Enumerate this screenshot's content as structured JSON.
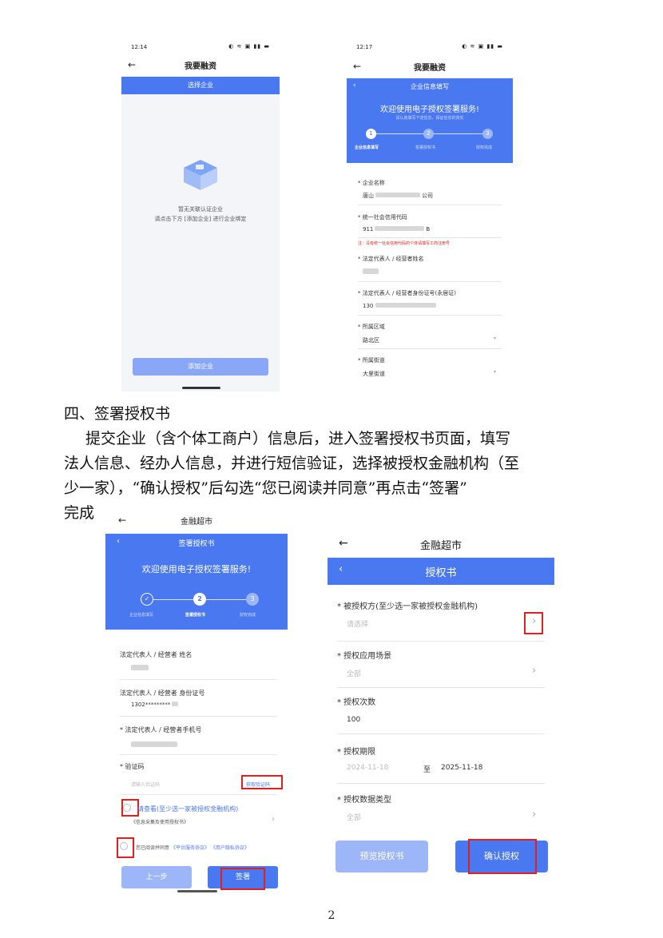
{
  "s1": {
    "time": "12:14",
    "status_icons": "◐ ≋ ▣ ▮▮ ▬",
    "title": "我要融资",
    "tab": "选择企业",
    "empty_line1": "暂无关联认证企业",
    "empty_line2": "请点击下方 [添加企业] 进行企业绑定",
    "add_button": "添加企业"
  },
  "s2": {
    "time": "12:17",
    "status_icons": "◐ ≋ ▣ ▮▮ ▬",
    "title": "我要融资",
    "header": "企业信息填写",
    "welcome": "欢迎使用电子授权签署服务!",
    "sub": "请认真填写下述信息，保证信息的真实",
    "steps": [
      {
        "num": "1",
        "label": "企业信息填写"
      },
      {
        "num": "2",
        "label": "签署授权书"
      },
      {
        "num": "3",
        "label": "授权完成"
      }
    ],
    "fields": [
      {
        "label": "* 企业名称",
        "value": "唐山",
        "suffix": "公司"
      },
      {
        "label": "* 统一社会信用代码",
        "value": "911",
        "suffix": "B"
      },
      {
        "label": "* 法定代表人 / 经营者姓名",
        "value": "",
        "suffix": ""
      },
      {
        "label": "* 法定代表人 / 经营者身份证号(永居证)",
        "value": "130",
        "suffix": ""
      },
      {
        "label": "* 所属区域",
        "value": "路北区",
        "suffix": ""
      },
      {
        "label": "* 所属街道",
        "value": "大里街道",
        "suffix": ""
      }
    ],
    "note": "注：没有统一社会信用代码的个体请填写工商注册号"
  },
  "doc": {
    "heading": "四、签署授权书",
    "para_line1": "提交企业（含个体工商户）信息后，进入签署授权书页面，填写",
    "para_line2": "法人信息、经办人信息，并进行短信验证，选择被授权金融机构（至",
    "para_line3": "少一家），“确认授权”后勾选“您已阅读并同意”再点击“签署”",
    "para_line4": "完成",
    "page_number": "2"
  },
  "s3": {
    "title": "金融超市",
    "header": "签署授权书",
    "welcome": "欢迎使用电子授权签署服务!",
    "steps": [
      {
        "num": "✓",
        "label": "企业信息填写"
      },
      {
        "num": "2",
        "label": "签署授权书"
      },
      {
        "num": "3",
        "label": "授权完成"
      }
    ],
    "field1_label": "法定代表人 / 经营者 姓名",
    "field2_label": "法定代表人 / 经营者 身份证号",
    "field2_value": "1302*********",
    "field3_label": "* 法定代表人 / 经营者手机号",
    "field4_label": "* 验证码",
    "code_placeholder": "请输入验证码",
    "get_code": "获取验证码",
    "view_label": "请查看(至少选一家被授权金融机构)",
    "view_sub": "《信息采集及使用授权书》",
    "agree_prefix": "您已阅读并同意",
    "agree_link1": "《平台服务协议》",
    "agree_link2": "《用户隐私协议》",
    "prev_button": "上一步",
    "sign_button": "签署"
  },
  "s4": {
    "title": "金融超市",
    "header": "授权书",
    "f1_label": "* 被授权方(至少选一家被授权金融机构)",
    "f1_placeholder": "请选择",
    "f2_label": "* 授权应用场景",
    "f2_value": "全部",
    "f3_label": "* 授权次数",
    "f3_value": "100",
    "f4_label": "* 授权期限",
    "f4_start": "2024-11-18",
    "f4_to": "至",
    "f4_end": "2025-11-18",
    "f5_label": "* 授权数据类型",
    "f5_value": "全部",
    "preview_button": "预览授权书",
    "confirm_button": "确认授权"
  },
  "colors": {
    "accent": "#4a78f0",
    "highlight": "#e02020"
  }
}
